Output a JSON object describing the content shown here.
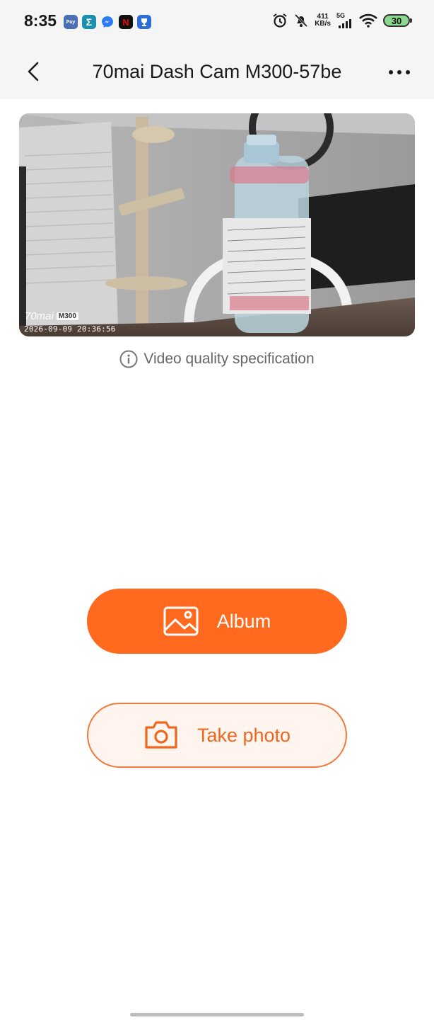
{
  "status_bar": {
    "time": "8:35",
    "net_speed_value": "411",
    "net_speed_unit": "KB/s",
    "network_type": "5G",
    "battery": "30",
    "notification_icons": [
      "payment-app-icon",
      "sigma-app-icon",
      "messenger-icon",
      "netflix-icon",
      "trophy-app-icon"
    ]
  },
  "header": {
    "title": "70mai Dash Cam M300-57be"
  },
  "preview": {
    "brand": "70mai",
    "model": "M300",
    "timestamp": "2026-09-09   20:36:56"
  },
  "quality_link": {
    "label": "Video quality specification"
  },
  "actions": {
    "album_label": "Album",
    "photo_label": "Take photo"
  },
  "colors": {
    "accent": "#ff6a1f",
    "accent_light": "#fff4ee",
    "header_bg": "#f5f5f5"
  }
}
